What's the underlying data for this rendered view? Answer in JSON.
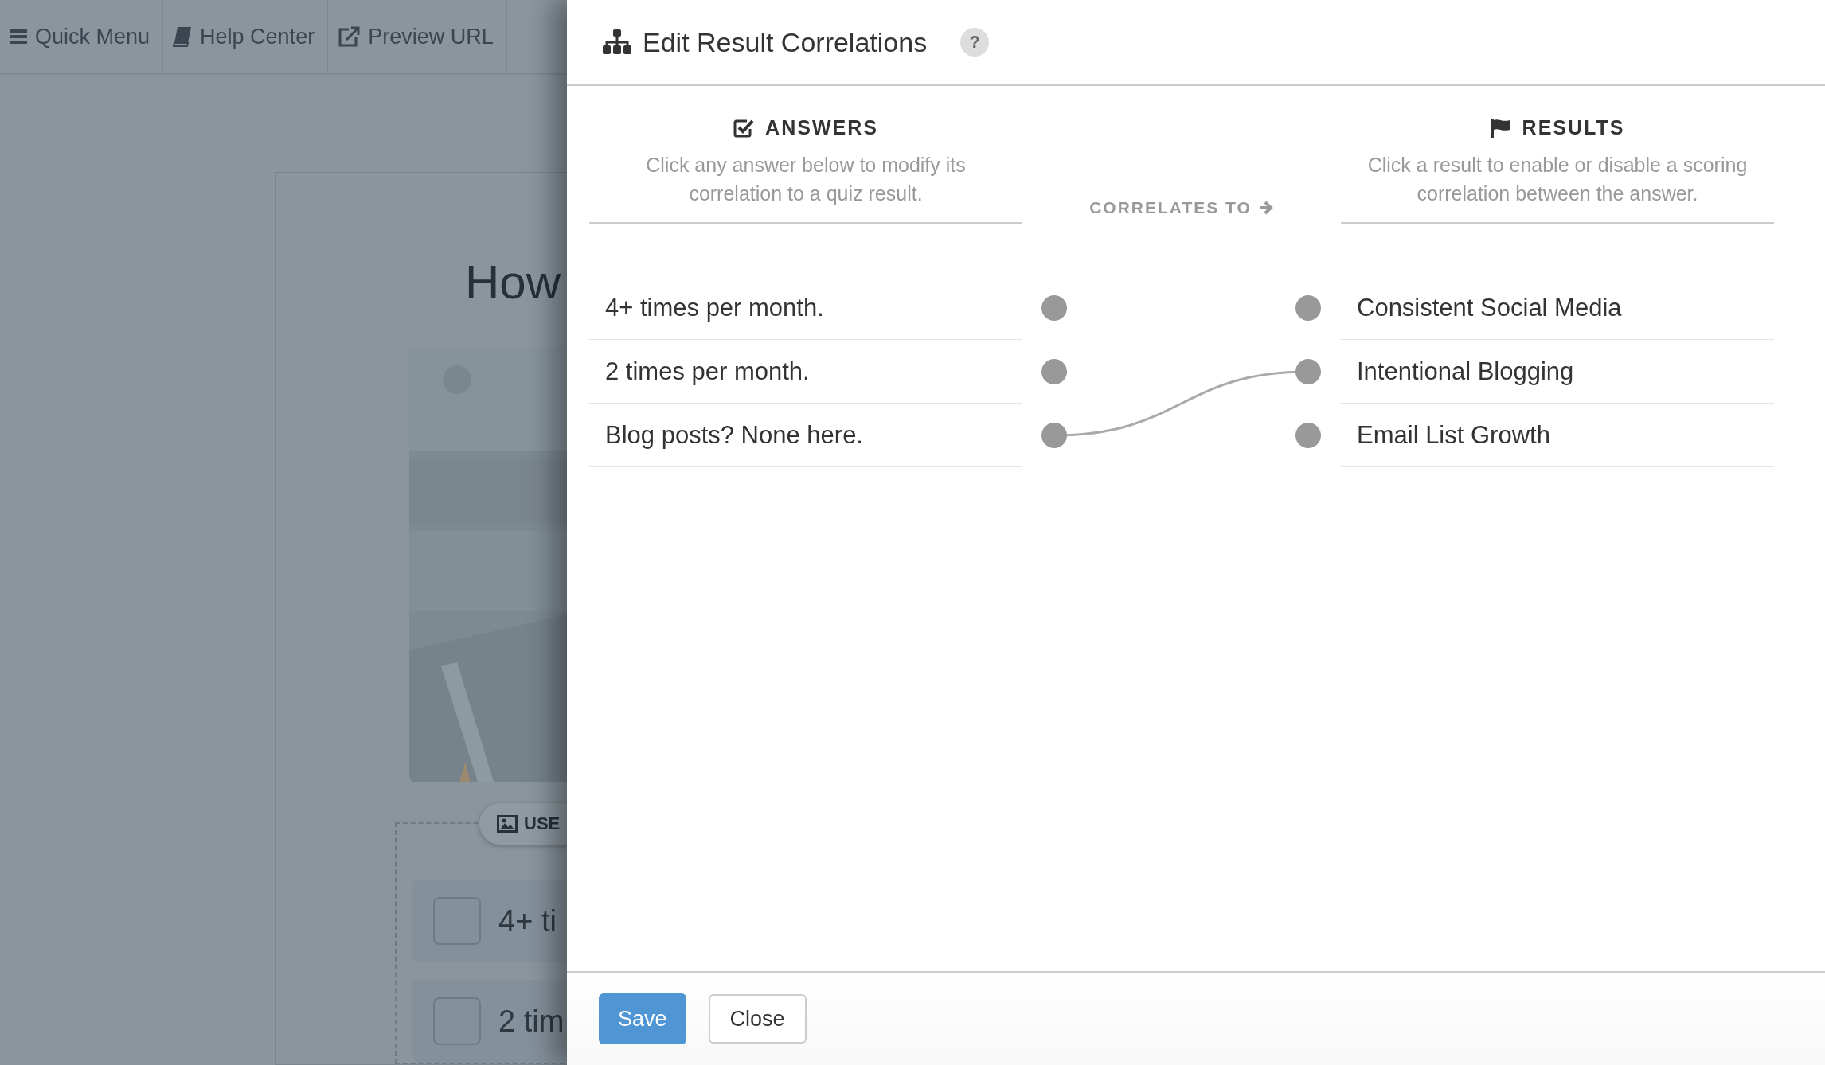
{
  "toolbar": {
    "items": [
      {
        "kind": "menu",
        "label": "Quick Menu"
      },
      {
        "kind": "help",
        "label": "Help Center"
      },
      {
        "kind": "preview",
        "label": "Preview URL"
      }
    ]
  },
  "background_page": {
    "heading": "How",
    "image_button": "USE",
    "options": [
      {
        "label": "4+ ti",
        "checked": false
      },
      {
        "label": "2 tim",
        "checked": false
      }
    ]
  },
  "dialog": {
    "title": "Edit Result Correlations",
    "help": "?",
    "answers_header": {
      "title": "ANSWERS",
      "description": "Click any answer below to modify its correlation to a quiz result."
    },
    "middle_label": "CORRELATES TO",
    "results_header": {
      "title": "RESULTS",
      "description": "Click a result to enable or disable a scoring correlation between the answer."
    },
    "answers": [
      {
        "label": "4+ times per month.",
        "selected": false
      },
      {
        "label": "2 times per month.",
        "selected": false
      },
      {
        "label": "Blog posts? None here.",
        "selected": true
      }
    ],
    "results": [
      {
        "label": "Consistent Social Media",
        "linked": false
      },
      {
        "label": "Intentional Blogging",
        "linked": true
      },
      {
        "label": "Email List Growth",
        "linked": false
      }
    ],
    "buttons": [
      {
        "kind": "primary",
        "label": "Save"
      },
      {
        "kind": "secondary",
        "label": "Close"
      }
    ]
  }
}
